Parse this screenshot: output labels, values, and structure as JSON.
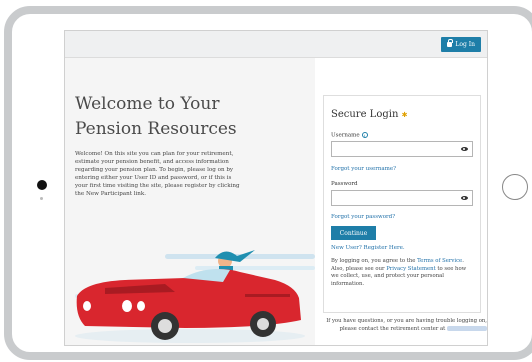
{
  "header": {
    "login_button_label": "Log In"
  },
  "welcome": {
    "title_line1": "Welcome to Your",
    "title_line2": "Pension Resources",
    "paragraph": "Welcome! On this site you can plan for your retirement, estimate your pension benefit, and access information regarding your pension plan. To begin, please log on by entering either your User ID and password, or if this is your first time visiting the site, please register by clicking the New Participant link."
  },
  "login": {
    "title": "Secure Login",
    "required_mark": "✱",
    "username_label": "Username",
    "username_value": "",
    "forgot_username": "Forgot your username?",
    "password_label": "Password",
    "password_value": "",
    "forgot_password": "Forgot your password?",
    "continue_label": "Continue",
    "new_user": "New User? Register Here.",
    "terms_part1": "By logging on, you agree to the ",
    "terms_link": "Terms of Service",
    "terms_part2": ". Also, please see our ",
    "privacy_link": "Privacy Statement",
    "terms_part3": " to see how we collect, use, and protect your personal information."
  },
  "footer": {
    "help_line1": "If you have questions, or you are having trouble logging on,",
    "help_line2": "please contact the retirement center at"
  },
  "colors": {
    "accent": "#1e7ea8",
    "car_red": "#d9262e",
    "page_bg": "#f5f5f5"
  }
}
